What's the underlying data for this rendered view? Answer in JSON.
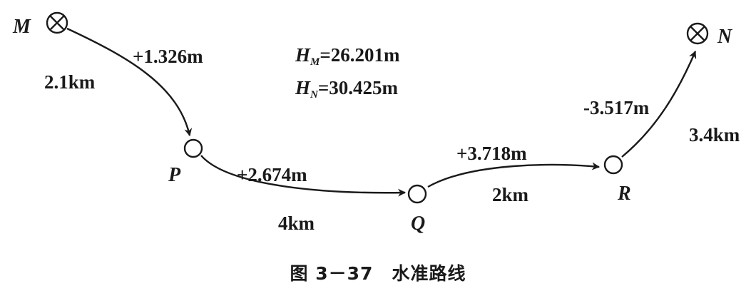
{
  "points": {
    "M": "M",
    "N": "N",
    "P": "P",
    "Q": "Q",
    "R": "R"
  },
  "segments": [
    {
      "from": "M",
      "to": "P",
      "dh": "+1.326m",
      "dist": "2.1km"
    },
    {
      "from": "P",
      "to": "Q",
      "dh": "+2.674m",
      "dist": "4km"
    },
    {
      "from": "Q",
      "to": "R",
      "dh": "+3.718m",
      "dist": "2km"
    },
    {
      "from": "R",
      "to": "N",
      "dh": "-3.517m",
      "dist": "3.4km"
    }
  ],
  "heights": {
    "HM_symbol": "H",
    "HM_sub": "M",
    "HM_value": "=26.201m",
    "HN_symbol": "H",
    "HN_sub": "N",
    "HN_value": "=30.425m"
  },
  "caption": {
    "figure_no": "图 3－37",
    "title": "水准路线"
  },
  "colors": {
    "ink": "#1a1a1a",
    "background": "#ffffff"
  }
}
